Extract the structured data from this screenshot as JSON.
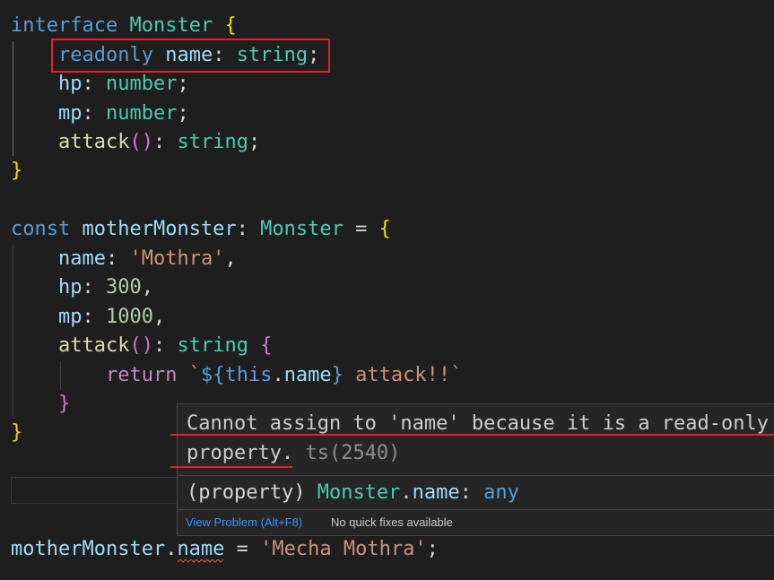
{
  "code": {
    "kw_interface": "interface",
    "type_monster": "Monster",
    "open_brace": "{",
    "close_brace": "}",
    "kw_readonly": "readonly",
    "prop_name": "name",
    "colon": ":",
    "type_string": "string",
    "semicolon": ";",
    "prop_hp": "hp",
    "type_number": "number",
    "prop_mp": "mp",
    "fn_attack": "attack",
    "parens": "()",
    "kw_const": "const",
    "var_mother": "motherMonster",
    "equals": "=",
    "str_mothra": "'Mothra'",
    "comma": ",",
    "num_300": "300",
    "num_1000": "1000",
    "kw_return": "return",
    "tmpl_open": "`${",
    "kw_this": "this",
    "dot": ".",
    "tmpl_close": "}",
    "tmpl_text": " attack!!`",
    "str_mecha": "'Mecha Mothra'"
  },
  "hover": {
    "error_line1": "Cannot assign to 'name' because it is a read-only",
    "error_line2": "property.",
    "error_code": " ts(2540)",
    "sig_prefix": "(property) ",
    "sig_type": "Monster",
    "sig_dot": ".",
    "sig_prop": "name",
    "sig_colon": ": ",
    "sig_any": "any",
    "view_problem": "View Problem (Alt+F8)",
    "no_fixes": "No quick fixes available"
  },
  "colors": {
    "accent_red": "#e5202a",
    "link_blue": "#3794ff"
  }
}
